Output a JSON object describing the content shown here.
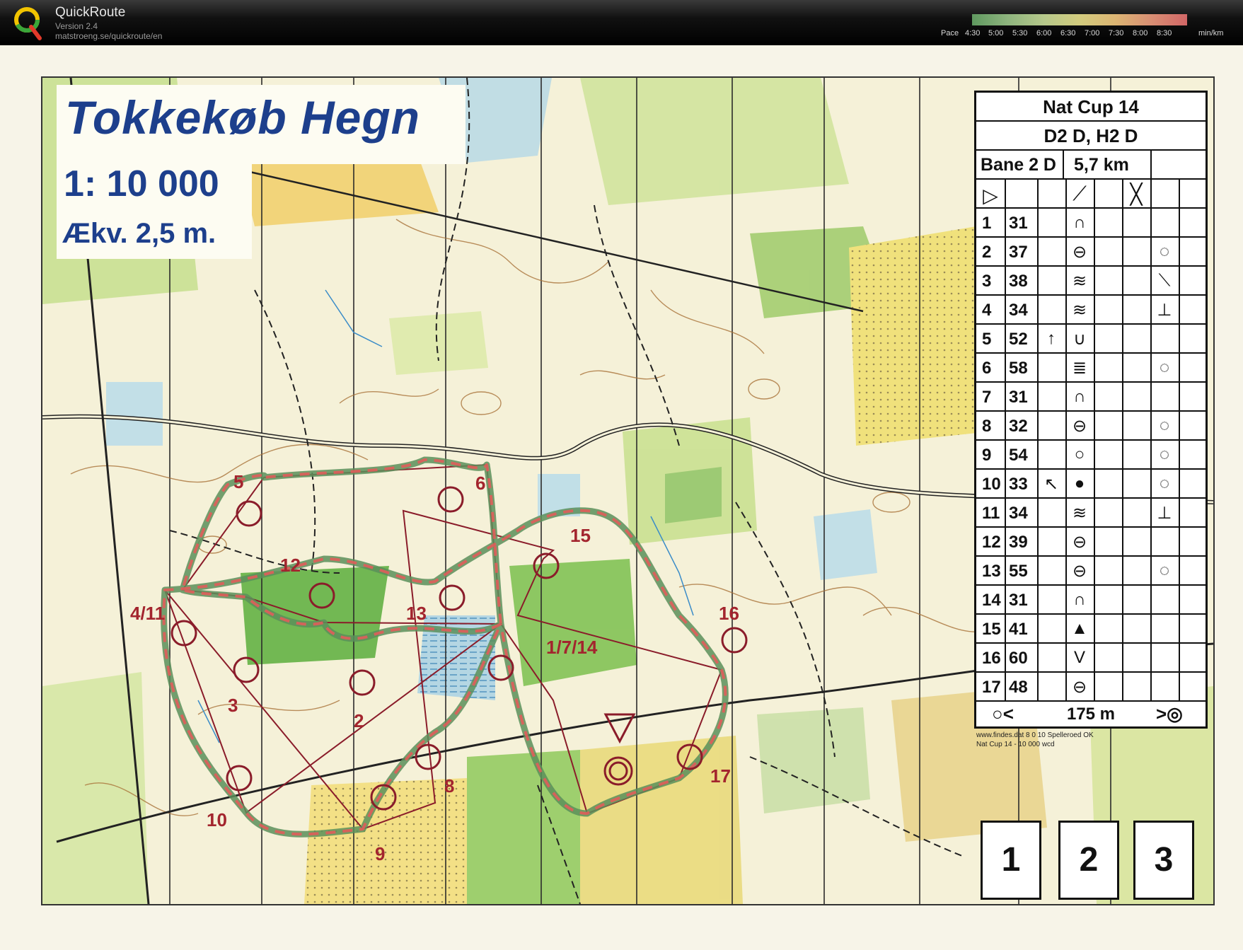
{
  "header": {
    "app_name": "QuickRoute",
    "version": "Version 2.4",
    "url": "matstroeng.se/quickroute/en",
    "pace_label": "Pace",
    "pace_ticks": [
      "4:30",
      "5:00",
      "5:30",
      "6:00",
      "6:30",
      "7:00",
      "7:30",
      "8:00",
      "8:30"
    ],
    "pace_unit": "min/km",
    "pace_colors": [
      "#68a868",
      "#e8e08a",
      "#e77070"
    ]
  },
  "map": {
    "title": "Tokkekøb Hegn",
    "scale": "1: 10 000",
    "equidistance": "Ækv. 2,5 m.",
    "printer_note_1": "www.findes.dat 8 0 10 Spelleroed OK",
    "printer_note_2": "Nat Cup 14 - 10 000 wcd",
    "start_boxes": [
      "1",
      "2",
      "3"
    ],
    "route_color": "#e05d5a",
    "course_color": "#a3252e"
  },
  "controls": {
    "labels": [
      "5",
      "6",
      "12",
      "15",
      "4/11",
      "13",
      "16",
      "1/7/14",
      "3",
      "2",
      "8",
      "17",
      "10",
      "9"
    ]
  },
  "description_sheet": {
    "event": "Nat Cup 14",
    "classes": "D2 D, H2 D",
    "course": "Bane 2 D",
    "length": "5,7 km",
    "finish_distance": "175 m",
    "rows": [
      {
        "num": "1",
        "code": "31",
        "dir": "",
        "feature": "∩",
        "where": ""
      },
      {
        "num": "2",
        "code": "37",
        "dir": "",
        "feature": "⊖",
        "where": "◌"
      },
      {
        "num": "3",
        "code": "38",
        "dir": "",
        "feature": "≋",
        "where": "⟍"
      },
      {
        "num": "4",
        "code": "34",
        "dir": "",
        "feature": "≋",
        "where": "⊥"
      },
      {
        "num": "5",
        "code": "52",
        "dir": "↑",
        "feature": "∪",
        "where": ""
      },
      {
        "num": "6",
        "code": "58",
        "dir": "",
        "feature": "≣",
        "where": "◌"
      },
      {
        "num": "7",
        "code": "31",
        "dir": "",
        "feature": "∩",
        "where": ""
      },
      {
        "num": "8",
        "code": "32",
        "dir": "",
        "feature": "⊖",
        "where": "◌"
      },
      {
        "num": "9",
        "code": "54",
        "dir": "",
        "feature": "○",
        "where": "◌"
      },
      {
        "num": "10",
        "code": "33",
        "dir": "↖",
        "feature": "●",
        "where": "◌"
      },
      {
        "num": "11",
        "code": "34",
        "dir": "",
        "feature": "≋",
        "where": "⊥"
      },
      {
        "num": "12",
        "code": "39",
        "dir": "",
        "feature": "⊖",
        "where": ""
      },
      {
        "num": "13",
        "code": "55",
        "dir": "",
        "feature": "⊖",
        "where": "◌"
      },
      {
        "num": "14",
        "code": "31",
        "dir": "",
        "feature": "∩",
        "where": ""
      },
      {
        "num": "15",
        "code": "41",
        "dir": "",
        "feature": "▲",
        "where": ""
      },
      {
        "num": "16",
        "code": "60",
        "dir": "",
        "feature": "V",
        "where": ""
      },
      {
        "num": "17",
        "code": "48",
        "dir": "",
        "feature": "⊖",
        "where": ""
      }
    ]
  }
}
